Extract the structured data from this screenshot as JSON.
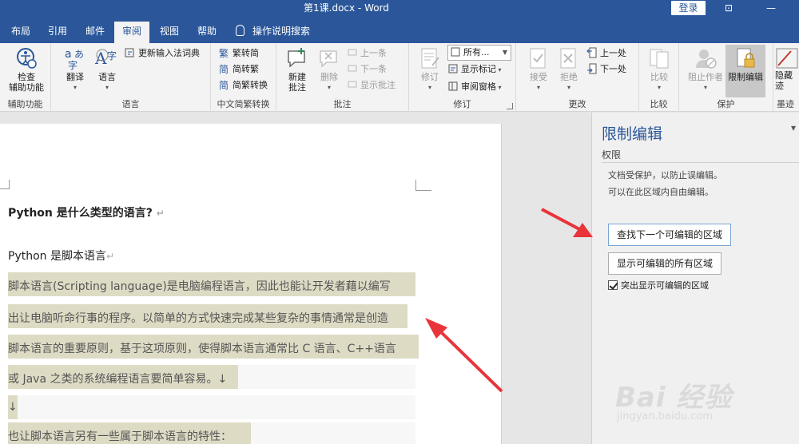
{
  "titlebar": {
    "doc_title": "第1课.docx - Word",
    "login": "登录",
    "ribbon_toggle_glyph": "⊡",
    "minimize_glyph": "—"
  },
  "tabs": [
    {
      "label": "布局"
    },
    {
      "label": "引用"
    },
    {
      "label": "邮件"
    },
    {
      "label": "审阅",
      "active": true
    },
    {
      "label": "视图"
    },
    {
      "label": "帮助"
    }
  ],
  "tell_me": "操作说明搜索",
  "ribbon": {
    "accessibility": {
      "check": "检查\n辅助功能",
      "label": "辅助功能"
    },
    "language": {
      "translate": "翻译",
      "language": "语言",
      "update_ime": "更新输入法词典",
      "label": "语言"
    },
    "chinese": {
      "to_simplified": "繁转简",
      "to_traditional": "简转繁",
      "convert": "简繁转换",
      "label": "中文简繁转换"
    },
    "comments": {
      "new": "新建\n批注",
      "delete": "删除",
      "previous": "上一条",
      "next": "下一条",
      "show": "显示批注",
      "label": "批注"
    },
    "tracking": {
      "track": "修订",
      "markup_select": "所有...",
      "show_markup": "显示标记",
      "review_pane": "审阅窗格",
      "label": "修订"
    },
    "changes": {
      "accept": "接受",
      "reject": "拒绝",
      "previous": "上一处",
      "next": "下一处",
      "label": "更改"
    },
    "compare": {
      "compare": "比较",
      "label": "比较"
    },
    "protect": {
      "block_authors": "阻止作者",
      "restrict_editing": "限制编辑",
      "label": "保护"
    },
    "ink": {
      "hide_ink": "隐藏\n迹",
      "label": "墨迹"
    }
  },
  "document": {
    "heading": "Python  是什么类型的语言?",
    "subheading": "Python 是脚本语言",
    "para_mark": "↵",
    "lines": [
      "脚本语言(Scripting language)是电脑编程语言，因此也能让开发者藉以编写",
      "出让电脑听命行事的程序。以简单的方式快速完成某些复杂的事情通常是创造",
      "脚本语言的重要原则，基于这项原则，使得脚本语言通常比  C 语言、C++语言",
      "或  Java  之类的系统编程语言要简单容易。↓",
      "↓",
      "也让脚本语言另有一些属于脚本语言的特性："
    ]
  },
  "pane": {
    "title": "限制编辑",
    "close": "▾",
    "section": "权限",
    "info1": "文档受保护，以防止误编辑。",
    "info2": "可以在此区域内自由编辑。",
    "btn_find_next": "查找下一个可编辑的区域",
    "btn_show_all": "显示可编辑的所有区域",
    "chk_highlight": "突出显示可编辑的区域"
  },
  "watermark": {
    "logo": "Bai 经验",
    "url": "jingyan.baidu.com"
  },
  "colors": {
    "word_blue": "#2b579a",
    "highlight": "#dedbc5",
    "arrow_red": "#e8343a"
  }
}
